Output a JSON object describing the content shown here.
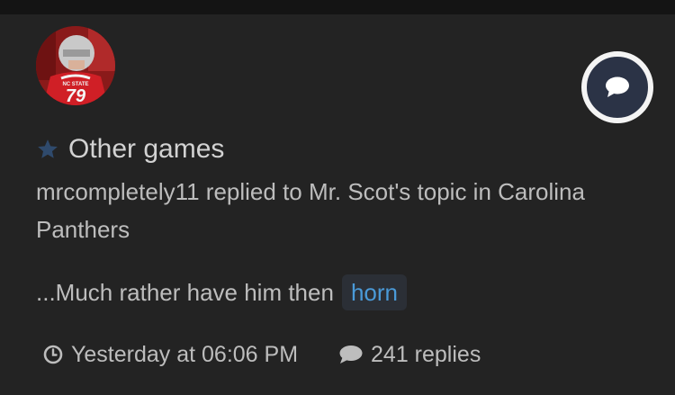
{
  "topic": {
    "title": "Other games",
    "activity": "mrcompletely11 replied to Mr. Scot's topic in Carolina Panthers",
    "excerpt": "...Much rather have him then",
    "tag": "horn",
    "timestamp": "Yesterday at 06:06 PM",
    "replies": "241 replies"
  },
  "avatar": {
    "jersey_number": "79",
    "jersey_text": "NC STATE"
  },
  "icons": {
    "star": "star-icon",
    "reply_badge": "comment-bubble-icon",
    "time": "clock-icon",
    "replies": "comment-icon"
  },
  "colors": {
    "background": "#232323",
    "star": "#2f4a6c",
    "tag_text": "#4a9ad8",
    "tag_bg": "#2b2f36",
    "badge_bg": "#2b3346",
    "badge_ring": "#f4f4f4"
  }
}
